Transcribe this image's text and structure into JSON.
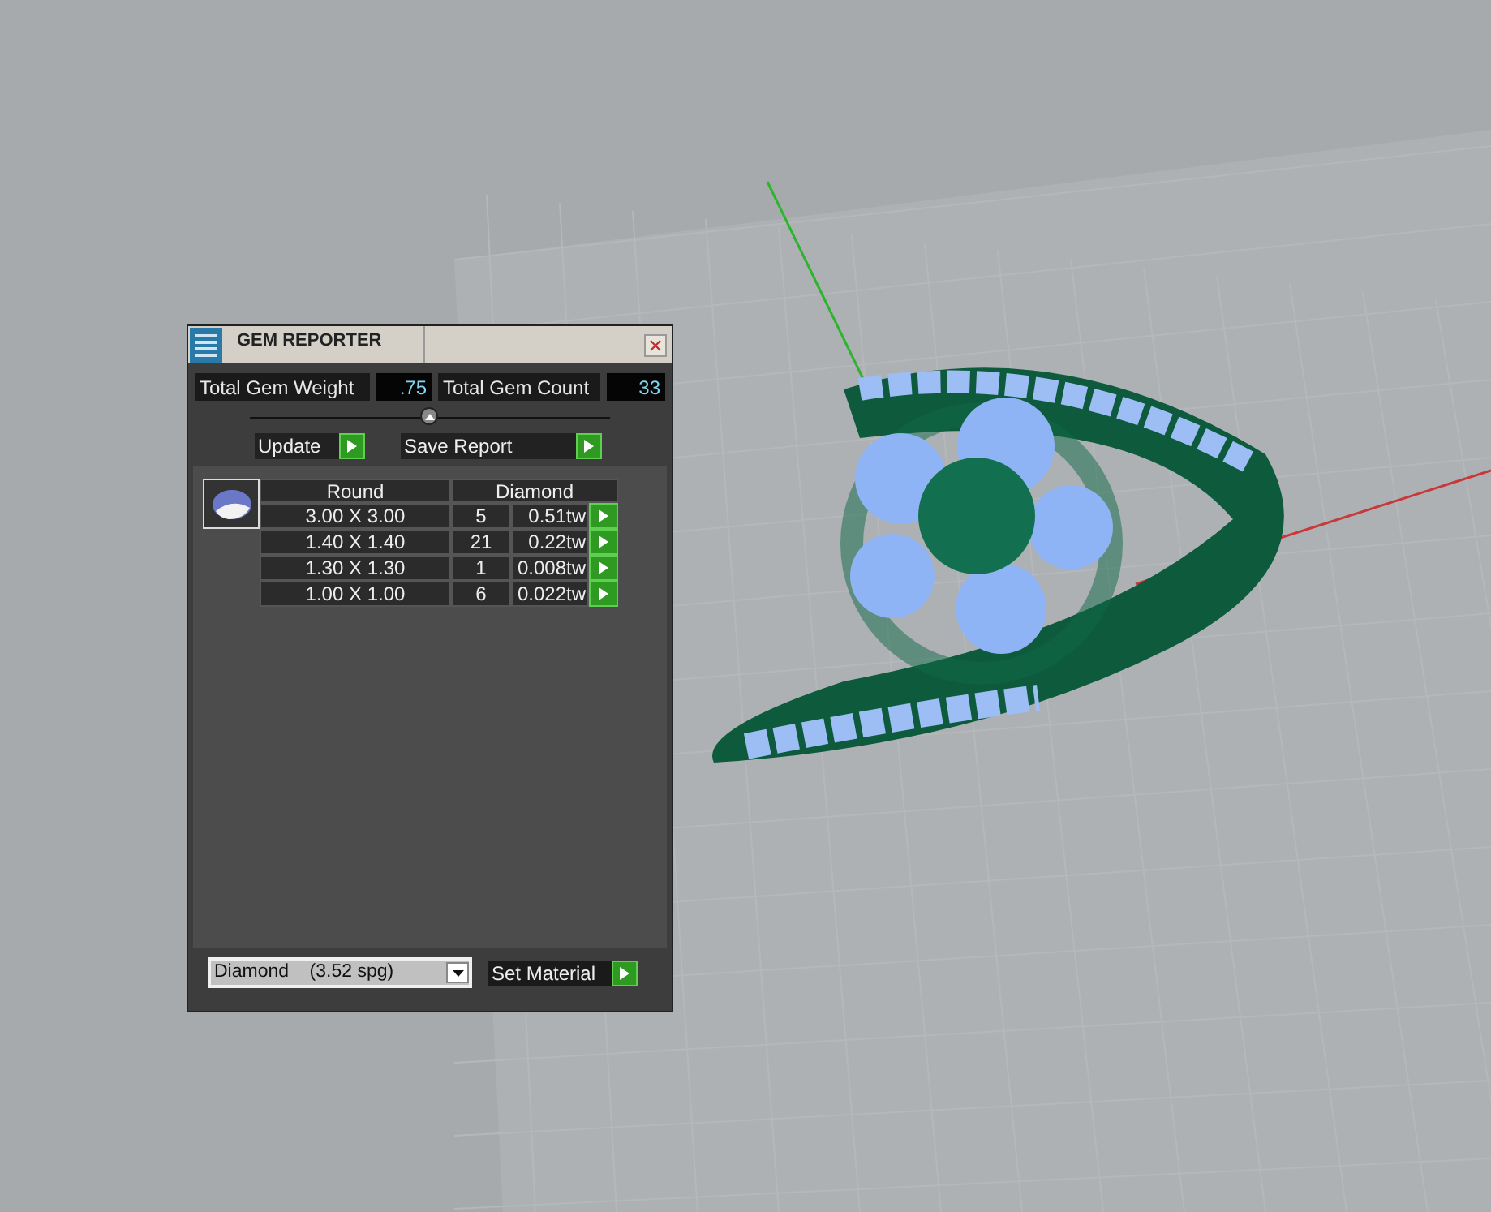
{
  "window": {
    "title": "GEM REPORTER"
  },
  "totals": [
    {
      "label": "Total Gem Weight",
      "value": ".75"
    },
    {
      "label": "Total Gem Count",
      "value": "33"
    }
  ],
  "buttons": [
    "Update",
    "Save Report"
  ],
  "table": {
    "columns": [
      "Round",
      "Diamond"
    ],
    "rows": [
      {
        "size": "3.00 X 3.00",
        "count": "5",
        "weight": "0.51tw"
      },
      {
        "size": "1.40 X 1.40",
        "count": "21",
        "weight": "0.22tw"
      },
      {
        "size": "1.30 X 1.30",
        "count": "1",
        "weight": "0.008tw"
      },
      {
        "size": "1.00 X 1.00",
        "count": "6",
        "weight": "0.022tw"
      }
    ]
  },
  "material": {
    "value": "Diamond    (3.52 spg)",
    "button": "Set Material"
  }
}
